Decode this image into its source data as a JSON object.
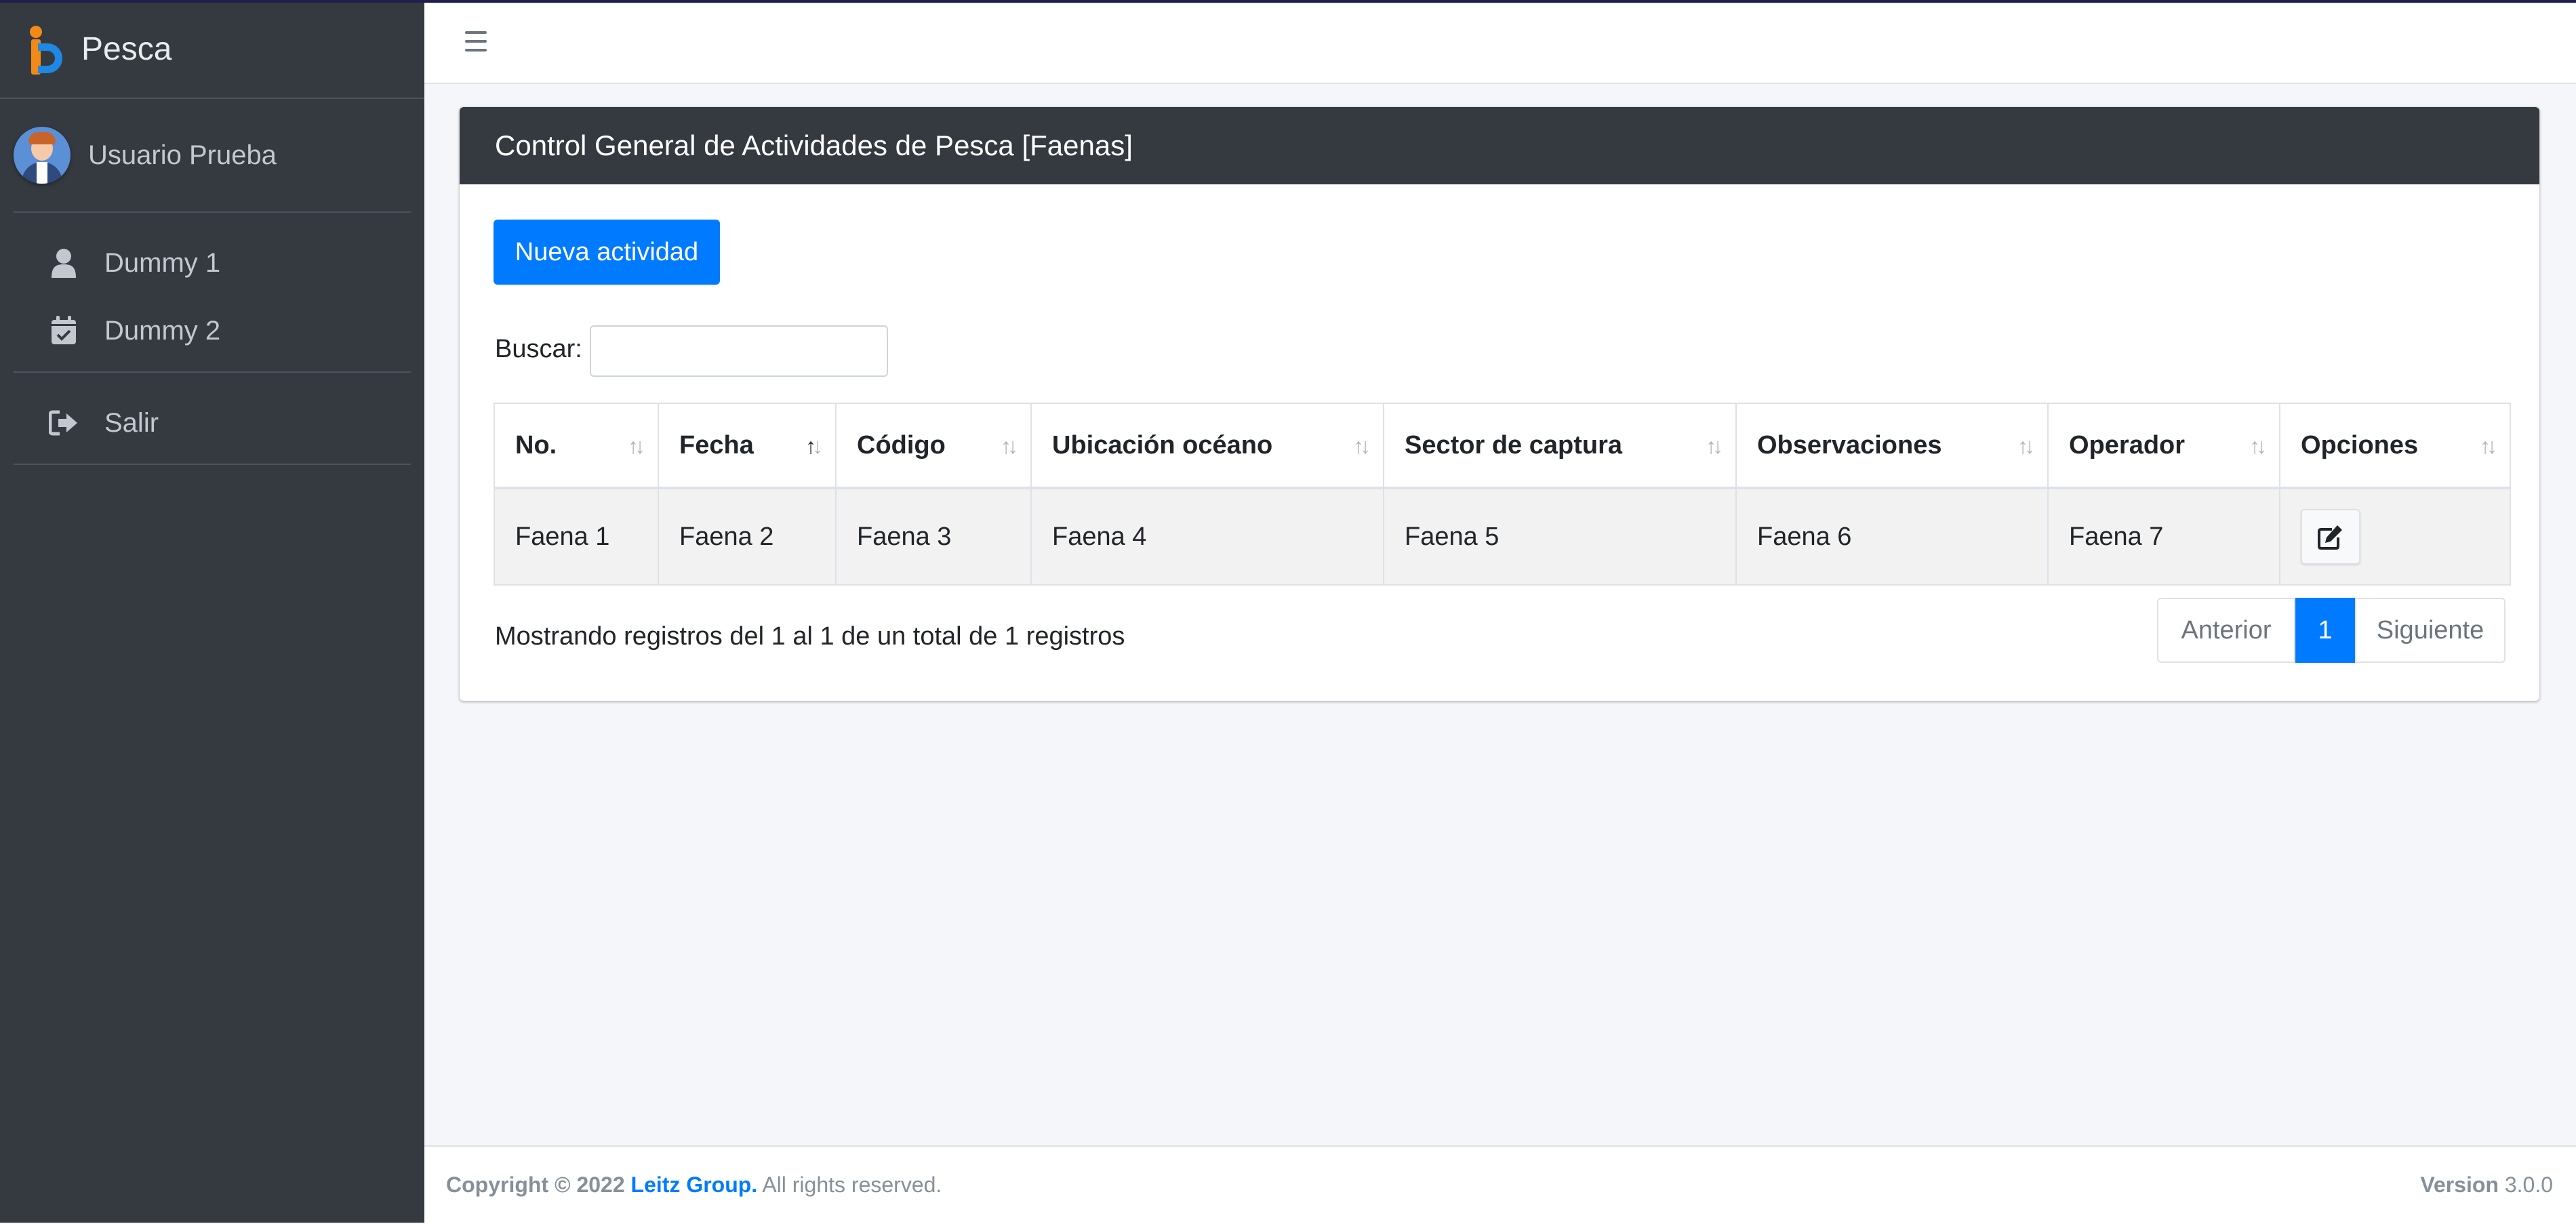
{
  "app": {
    "brand": "Pesca"
  },
  "user": {
    "name": "Usuario Prueba"
  },
  "sidebar": {
    "items": [
      {
        "label": "Dummy 1",
        "icon": "user-icon"
      },
      {
        "label": "Dummy 2",
        "icon": "calendar-check-icon"
      },
      {
        "label": "Salir",
        "icon": "sign-out-icon"
      }
    ]
  },
  "card": {
    "title": "Control General de Actividades de Pesca [Faenas]",
    "new_button": "Nueva actividad",
    "search_label": "Buscar:",
    "search_value": ""
  },
  "table": {
    "columns": [
      "No.",
      "Fecha",
      "Código",
      "Ubicación océano",
      "Sector de captura",
      "Observaciones",
      "Operador",
      "Opciones"
    ],
    "sorted_column": "Fecha",
    "sorted_direction": "ascending",
    "rows": [
      [
        "Faena 1",
        "Faena 2",
        "Faena 3",
        "Faena 4",
        "Faena 5",
        "Faena 6",
        "Faena 7"
      ]
    ]
  },
  "pagination": {
    "info": "Mostrando registros del 1 al 1 de un total de 1 registros",
    "previous": "Anterior",
    "current": "1",
    "next": "Siguiente"
  },
  "footer": {
    "copyright": "Copyright © 2022",
    "company": "Leitz Group.",
    "rights": "All rights reserved.",
    "version_label": "Version",
    "version": "3.0.0"
  },
  "colors": {
    "primary": "#007bff",
    "sidebar": "#343a40",
    "accent": "#f28a18"
  }
}
